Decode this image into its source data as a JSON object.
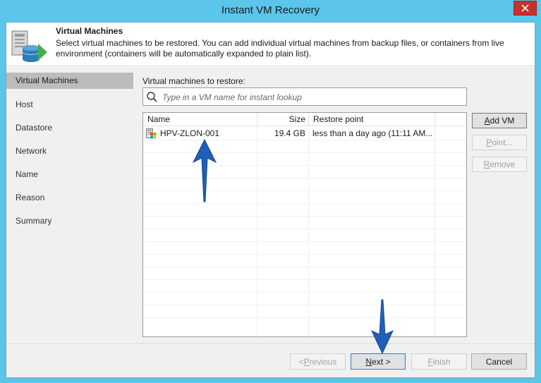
{
  "window": {
    "title": "Instant VM Recovery"
  },
  "header": {
    "title": "Virtual Machines",
    "description": "Select virtual machines to be restored. You  can add individual virtual machines from backup files, or containers from live environment (containers will be automatically expanded to plain list)."
  },
  "sidebar": {
    "items": [
      {
        "label": "Virtual Machines",
        "active": true
      },
      {
        "label": "Host",
        "active": false
      },
      {
        "label": "Datastore",
        "active": false
      },
      {
        "label": "Network",
        "active": false
      },
      {
        "label": "Name",
        "active": false
      },
      {
        "label": "Reason",
        "active": false
      },
      {
        "label": "Summary",
        "active": false
      }
    ]
  },
  "main": {
    "section_label": "Virtual machines to restore:",
    "search": {
      "placeholder": "Type in a VM name for instant lookup",
      "value": ""
    },
    "table": {
      "columns": [
        "Name",
        "Size",
        "Restore point"
      ],
      "rows": [
        {
          "name": "HPV-ZLON-001",
          "size": "19.4 GB",
          "restore_point": "less than a day ago (11:11 AM..."
        }
      ]
    },
    "buttons": {
      "add_vm": {
        "u": "A",
        "rest": "dd VM"
      },
      "point": {
        "u": "P",
        "rest": "oint..."
      },
      "remove": {
        "u": "R",
        "rest": "emove"
      }
    }
  },
  "footer": {
    "previous": {
      "prefix": "< ",
      "u": "P",
      "rest": "revious"
    },
    "next": {
      "u": "N",
      "rest": "ext >"
    },
    "finish": {
      "u": "F",
      "rest": "inish"
    },
    "cancel": "Cancel"
  },
  "colors": {
    "frame": "#5bc5ea",
    "close_button": "#c7312b",
    "sidebar_active": "#bcbcbc",
    "annotation_arrow": "#1f5fb8"
  }
}
